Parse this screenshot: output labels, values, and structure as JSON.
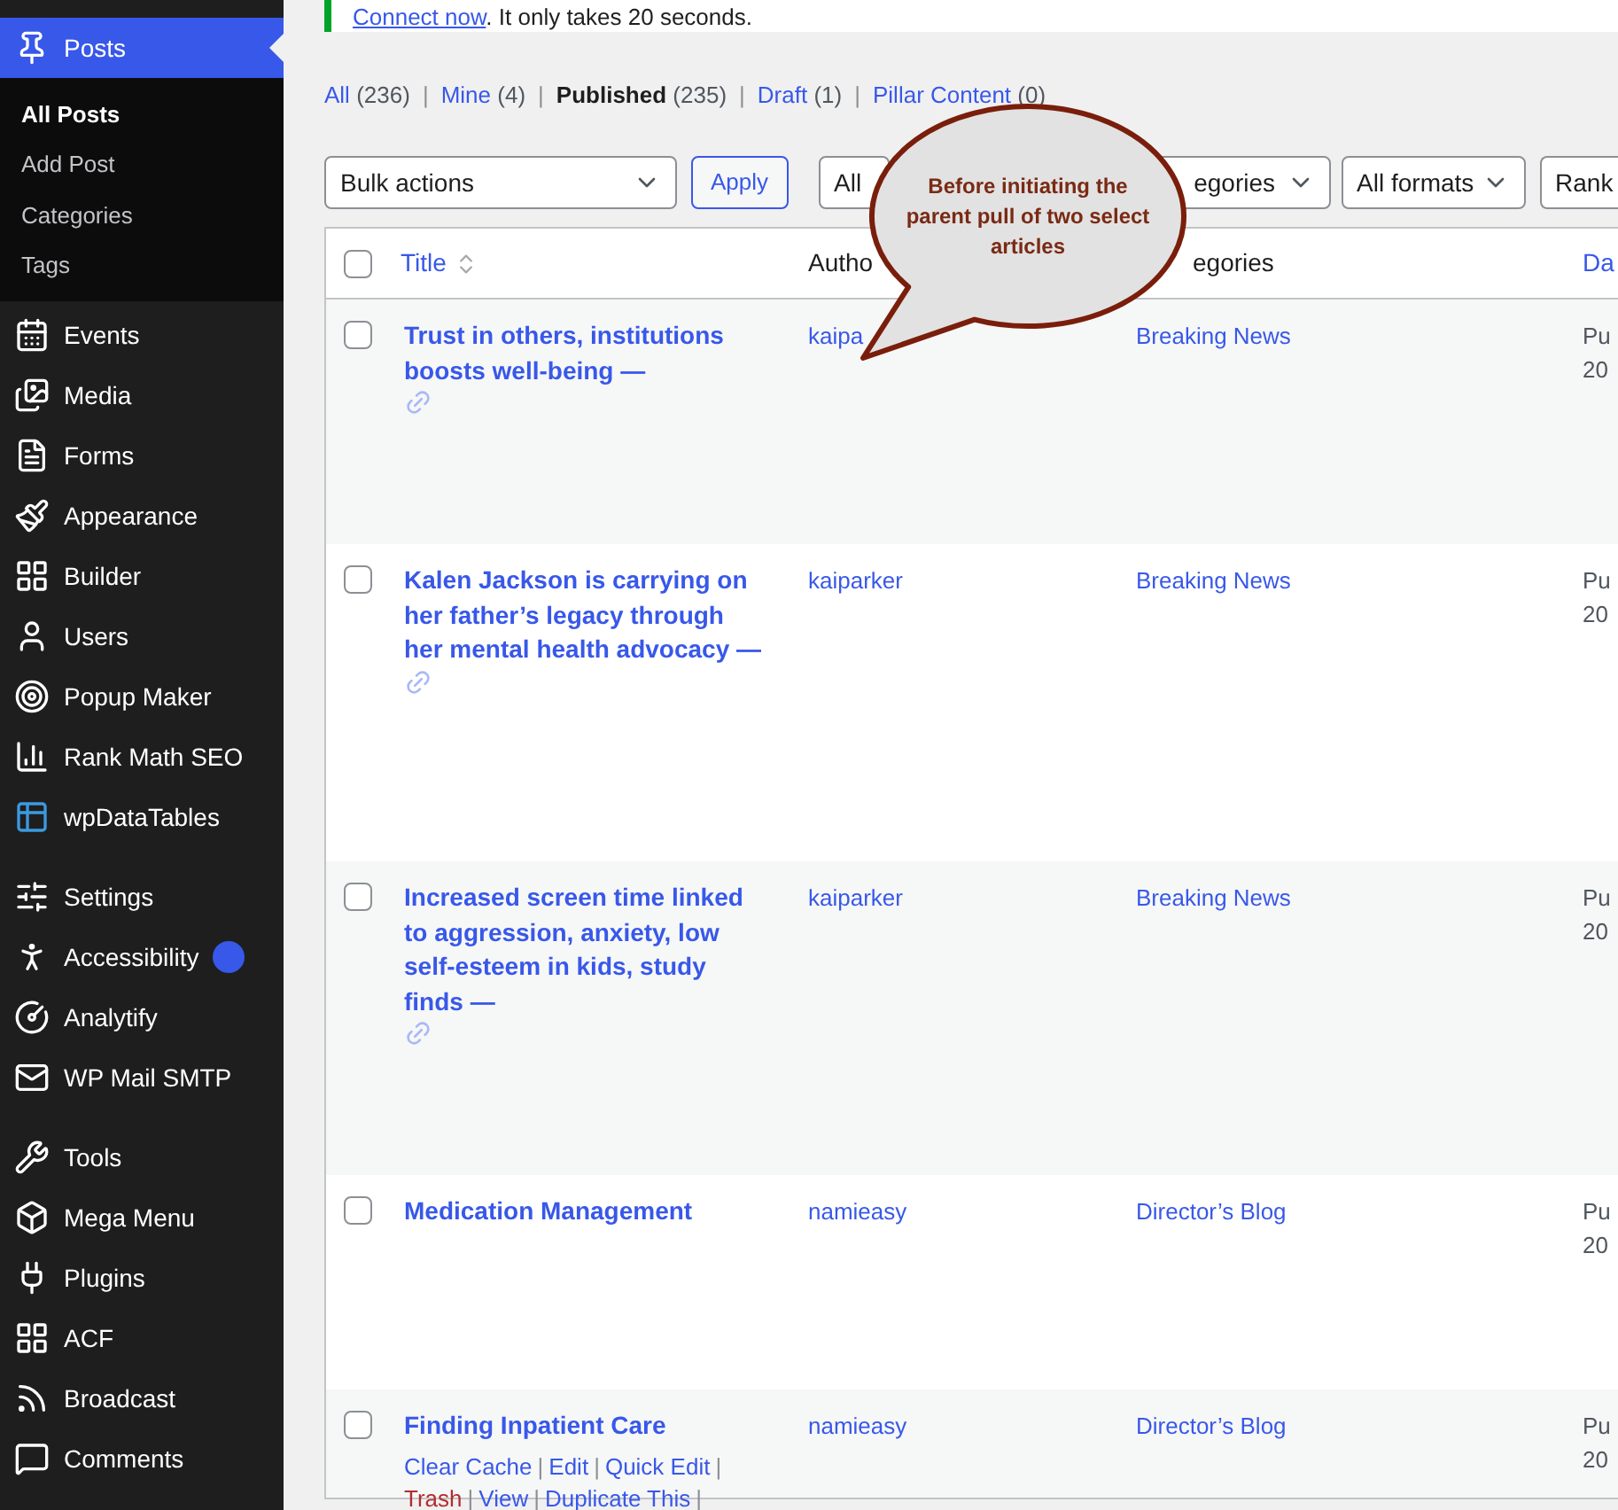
{
  "notice": {
    "link": "Connect now",
    "text": ". It only takes 20 seconds."
  },
  "sidebar": {
    "current": {
      "label": "Posts",
      "submenu": [
        {
          "label": "All Posts",
          "selected": true
        },
        {
          "label": "Add Post",
          "selected": false
        },
        {
          "label": "Categories",
          "selected": false
        },
        {
          "label": "Tags",
          "selected": false
        }
      ]
    },
    "groups": [
      [
        {
          "label": "Events",
          "badge": false
        },
        {
          "label": "Media",
          "badge": false
        },
        {
          "label": "Forms",
          "badge": false
        },
        {
          "label": "Appearance",
          "badge": false
        },
        {
          "label": "Builder",
          "badge": false
        },
        {
          "label": "Users",
          "badge": false
        },
        {
          "label": "Popup Maker",
          "badge": false
        },
        {
          "label": "Rank Math SEO",
          "badge": false
        },
        {
          "label": "wpDataTables",
          "badge": false
        }
      ],
      [
        {
          "label": "Settings",
          "badge": false
        },
        {
          "label": "Accessibility",
          "badge": true
        },
        {
          "label": "Analytify",
          "badge": false
        },
        {
          "label": "WP Mail SMTP",
          "badge": false
        }
      ],
      [
        {
          "label": "Tools",
          "badge": false
        },
        {
          "label": "Mega Menu",
          "badge": false
        },
        {
          "label": "Plugins",
          "badge": false
        },
        {
          "label": "ACF",
          "badge": false
        },
        {
          "label": "Broadcast",
          "badge": false
        },
        {
          "label": "Comments",
          "badge": false
        }
      ]
    ]
  },
  "views": {
    "separator": "|",
    "items": [
      {
        "label": "All",
        "count": "(236)",
        "selected": false
      },
      {
        "label": "Mine",
        "count": "(4)",
        "selected": false
      },
      {
        "label": "Published",
        "count": "(235)",
        "selected": true
      },
      {
        "label": "Draft",
        "count": "(1)",
        "selected": false
      },
      {
        "label": "Pillar Content",
        "count": "(0)",
        "selected": false
      }
    ]
  },
  "filters": {
    "bulk_actions": "Bulk actions",
    "apply": "Apply",
    "selects": [
      "All",
      "egories",
      "All formats",
      "Rank"
    ]
  },
  "callout": {
    "text": "Before initiating the parent pull of two select articles"
  },
  "table": {
    "select_all_checked": false,
    "columns": [
      "Title",
      "Autho",
      "egories",
      "Da"
    ],
    "rows": [
      {
        "title": "Trust in others, institutions boosts well-being —",
        "link_icon": true,
        "author": "kaipa",
        "category": "Breaking News",
        "date": [
          "Pu",
          "20"
        ],
        "checked": false
      },
      {
        "title": "Kalen Jackson is carrying on her father’s legacy through her mental health advocacy —",
        "link_icon": true,
        "author": "kaiparker",
        "category": "Breaking News",
        "date": [
          "Pu",
          "20"
        ],
        "checked": false
      },
      {
        "title": "Increased screen time linked to aggression, anxiety, low self-esteem in kids, study finds —",
        "link_icon": true,
        "author": "kaiparker",
        "category": "Breaking News",
        "date": [
          "Pu",
          "20"
        ],
        "checked": false
      },
      {
        "title": "Medication Management",
        "link_icon": false,
        "author": "namieasy",
        "category": "Director’s Blog",
        "date": [
          "Pu",
          "20"
        ],
        "checked": false
      },
      {
        "title": "Finding Inpatient Care",
        "link_icon": false,
        "author": "namieasy",
        "category": "Director’s Blog",
        "date": [
          "Pu",
          "20"
        ],
        "checked": false,
        "actions": {
          "separator": "|",
          "items": [
            {
              "label": "Clear Cache",
              "kind": "normal"
            },
            {
              "label": "Edit",
              "kind": "normal"
            },
            {
              "label": "Quick Edit",
              "kind": "normal"
            },
            {
              "label": "Trash",
              "kind": "danger"
            },
            {
              "label": "View",
              "kind": "normal"
            },
            {
              "label": "Duplicate This",
              "kind": "normal"
            }
          ]
        }
      }
    ]
  }
}
